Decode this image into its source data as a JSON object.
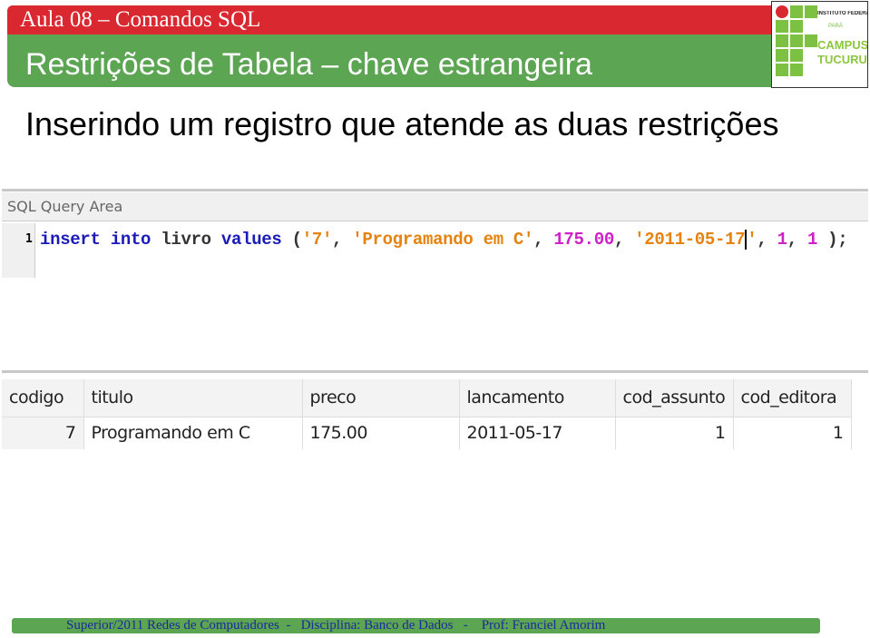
{
  "header": {
    "course": "Aula 08 – Comandos SQL",
    "title": "Restrições de Tabela – chave estrangeira"
  },
  "logo": {
    "line1": "INSTITUTO FEDERAL",
    "line2": "PARÁ",
    "line3": "CAMPUS TUCURUÍ"
  },
  "subtitle": "Inserindo um registro que atende as duas restrições",
  "query_area": {
    "label": "SQL Query Area",
    "line_number": "1",
    "tokens": [
      "insert",
      "into",
      "livro",
      "values",
      "(",
      "'7'",
      "'Programando em C'",
      "175.00",
      "'2011-05-17",
      "'",
      "1",
      "1",
      ");"
    ]
  },
  "result": {
    "columns": [
      "codigo",
      "titulo",
      "preco",
      "lancamento",
      "cod_assunto",
      "cod_editora"
    ],
    "rows": [
      [
        "7",
        "Programando em C",
        "175.00",
        "2011-05-17",
        "1",
        "1"
      ]
    ]
  },
  "footer": "Superior/2011 Redes de Computadores  -   Disciplina: Banco de Dados   -    Prof: Franciel Amorim",
  "colors": {
    "red": "#d9282f",
    "green": "#5ca552",
    "keyword": "#1a1ab8",
    "string": "#e6820e",
    "number": "#d020c8"
  }
}
